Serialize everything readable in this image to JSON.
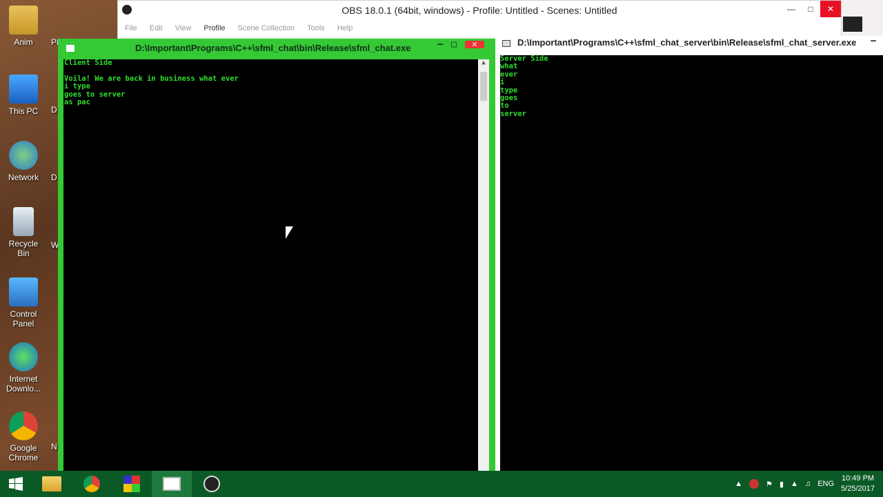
{
  "desktop": {
    "icons": [
      {
        "label": "Anim",
        "partial": "Pi"
      },
      {
        "label": "This PC",
        "partial": "D"
      },
      {
        "label": "Network",
        "partial": "D"
      },
      {
        "label": "Recycle Bin",
        "partial": "W"
      },
      {
        "label": "Control Panel",
        "partial": ""
      },
      {
        "label": "Internet Downlo...",
        "partial": ""
      },
      {
        "label": "Google Chrome",
        "partial": "N"
      }
    ]
  },
  "obs": {
    "title": "OBS 18.0.1 (64bit, windows) - Profile: Untitled - Scenes: Untitled",
    "menu": [
      "File",
      "Edit",
      "View",
      "Profile",
      "Scene Collection",
      "Tools",
      "Help"
    ]
  },
  "client_window": {
    "title": "D:\\Important\\Programs\\C++\\sfml_chat\\bin\\Release\\sfml_chat.exe",
    "lines": [
      "Client Side",
      "",
      "Voila! We are back in business what ever",
      "i type",
      "goes to server",
      "as pac"
    ]
  },
  "server_window": {
    "title": "D:\\Important\\Programs\\C++\\sfml_chat_server\\bin\\Release\\sfml_chat_server.exe",
    "lines": [
      "Server Side",
      "what",
      "ever",
      "i",
      "type",
      "goes",
      "to",
      "server"
    ]
  },
  "taskbar": {
    "language": "ENG",
    "time": "10:49 PM",
    "date": "5/25/2017"
  },
  "colors": {
    "console_text": "#2fdc2f",
    "taskbar": "#0b5a26",
    "client_frame": "#35c935"
  }
}
